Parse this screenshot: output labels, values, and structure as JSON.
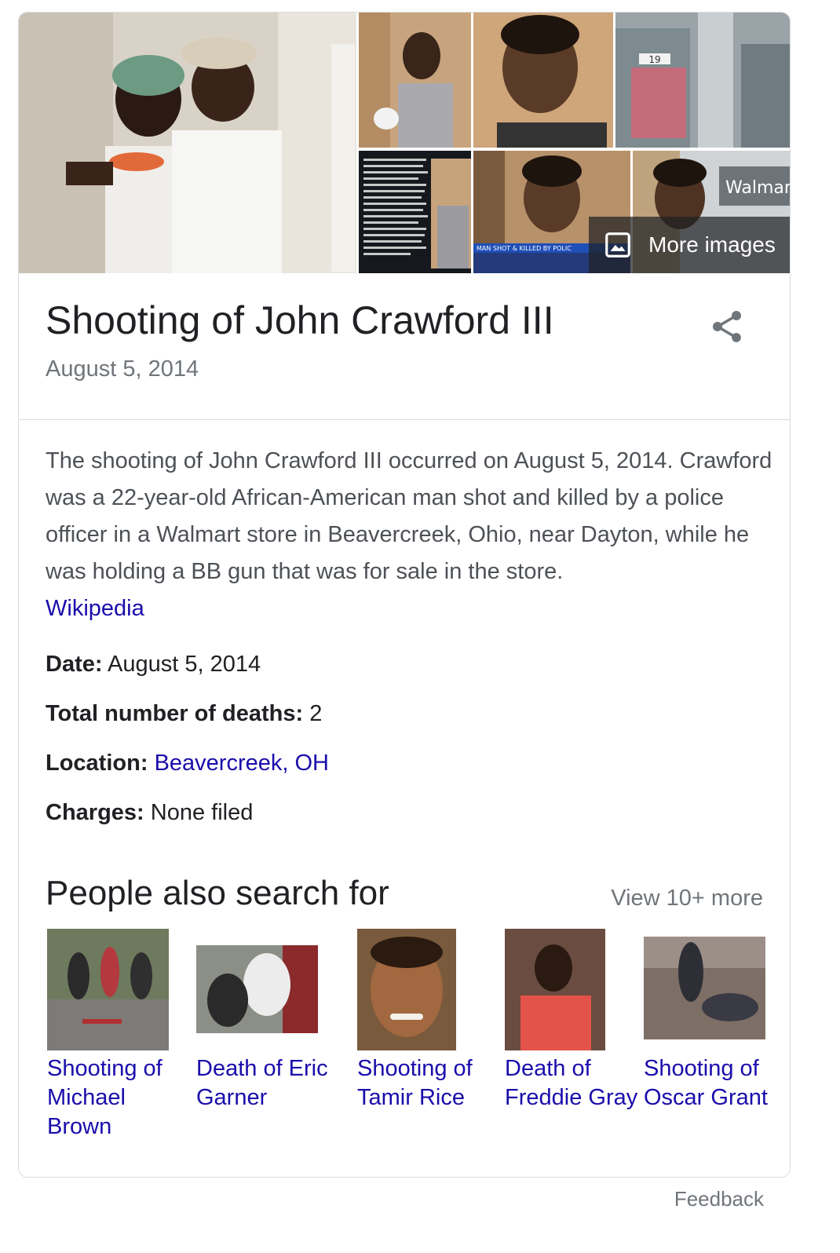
{
  "gallery": {
    "more_images_label": "More images",
    "photos": [
      {
        "name": "woman-and-man-photo",
        "overlay": ""
      },
      {
        "name": "man-holding-item-photo",
        "overlay": ""
      },
      {
        "name": "man-portrait-photo",
        "overlay": ""
      },
      {
        "name": "store-aisle-photo",
        "overlay": "19"
      },
      {
        "name": "article-text-photo",
        "overlay": ""
      },
      {
        "name": "news-broadcast-photo",
        "overlay": "MAN SHOT & KILLED BY POLIC"
      },
      {
        "name": "walmart-portrait-photo",
        "overlay": "Walmar"
      }
    ]
  },
  "header": {
    "title": "Shooting of John Crawford III",
    "subtitle": "August 5, 2014"
  },
  "description": {
    "text": "The shooting of John Crawford III occurred on August 5, 2014. Crawford was a 22-year-old African-American man shot and killed by a police officer in a Walmart store in Beavercreek, Ohio, near Dayton, while he was holding a BB gun that was for sale in the store.",
    "source": "Wikipedia"
  },
  "facts": [
    {
      "label": "Date:",
      "value": "August 5, 2014"
    },
    {
      "label": "Total number of deaths:",
      "value": "2"
    },
    {
      "label": "Location:",
      "value": "Beavercreek, OH"
    },
    {
      "label": "Charges:",
      "value": "None filed"
    }
  ],
  "people_also_search": {
    "title": "People also search for",
    "view_more": "View 10+ more",
    "items": [
      {
        "label": "Shooting of Michael Brown"
      },
      {
        "label": "Death of Eric Garner"
      },
      {
        "label": "Shooting of Tamir Rice"
      },
      {
        "label": "Death of Freddie Gray"
      },
      {
        "label": "Shooting of Oscar Grant"
      }
    ]
  },
  "footer": {
    "feedback": "Feedback"
  },
  "colors": {
    "link": "#1a0dab",
    "muted": "#70757a",
    "text": "#202124",
    "border": "#dadce0"
  }
}
